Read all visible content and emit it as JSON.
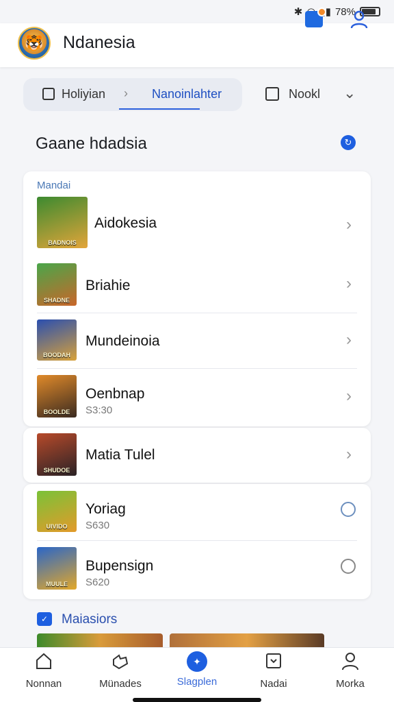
{
  "status_bar": {
    "battery_text": "78%"
  },
  "app": {
    "title": "Ndanesia"
  },
  "tabs": {
    "tab1_label": "Holiyian",
    "separator": "›",
    "tab2_label": "Nanoinlahter",
    "tab3_label": "Nookl"
  },
  "section": {
    "title": "Gaane hdadsia"
  },
  "list": {
    "group_label": "Mandai",
    "items": [
      {
        "title": "Aidokesia",
        "subtitle": ""
      },
      {
        "title": "Briahie",
        "subtitle": ""
      },
      {
        "title": "Mundeinoia",
        "subtitle": ""
      },
      {
        "title": "Oenbnap",
        "subtitle": "S3:30"
      },
      {
        "title": "Matia Tulel",
        "subtitle": ""
      },
      {
        "title": "Yoriag",
        "subtitle": "S630"
      },
      {
        "title": "Bupensign",
        "subtitle": "S620"
      }
    ]
  },
  "thumbnails": [
    {
      "caption": "BADNOIS",
      "colors": [
        "#3c8a30",
        "#e3a53a"
      ]
    },
    {
      "caption": "SHADNE",
      "colors": [
        "#4aa64a",
        "#c9662a"
      ]
    },
    {
      "caption": "BOODAH",
      "colors": [
        "#2a4fb0",
        "#d8a23a"
      ]
    },
    {
      "caption": "BOOLDE",
      "colors": [
        "#e08a2a",
        "#3a2a20"
      ]
    },
    {
      "caption": "SHUDOE",
      "colors": [
        "#b74a2a",
        "#2a2226"
      ]
    },
    {
      "caption": "UIVIDO",
      "colors": [
        "#7ac238",
        "#e39a2a"
      ]
    },
    {
      "caption": "MUULE",
      "colors": [
        "#2a66c8",
        "#e3a82a"
      ]
    }
  ],
  "sub_section": {
    "title": "Maiasiors"
  },
  "bottom_nav": [
    {
      "label": "Nonnan",
      "icon": "home-icon"
    },
    {
      "label": "Münades",
      "icon": "hand-icon"
    },
    {
      "label": "Slagplen",
      "icon": "compass-icon"
    },
    {
      "label": "Nadai",
      "icon": "message-icon"
    },
    {
      "label": "Morka",
      "icon": "profile-icon"
    }
  ],
  "colors": {
    "accent": "#1e5fe0",
    "tab_active": "#1e4fc2",
    "notif_badge": "#f28a2a"
  }
}
